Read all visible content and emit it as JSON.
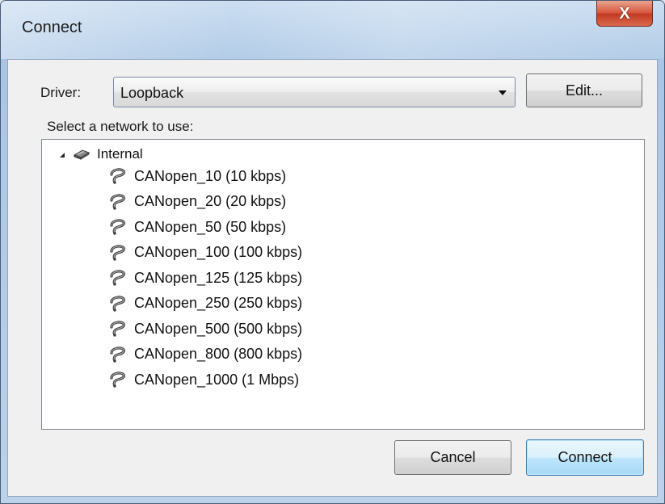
{
  "window": {
    "title": "Connect",
    "close_glyph": "X"
  },
  "driver": {
    "label": "Driver:",
    "selected": "Loopback",
    "edit_label": "Edit..."
  },
  "network": {
    "label": "Select a network to use:",
    "root": {
      "label": "Internal",
      "icon": "network-adapter-icon",
      "expanded": true
    },
    "items": [
      {
        "label": "CANopen_10 (10 kbps)",
        "icon": "connection-icon"
      },
      {
        "label": "CANopen_20 (20 kbps)",
        "icon": "connection-icon"
      },
      {
        "label": "CANopen_50 (50 kbps)",
        "icon": "connection-icon"
      },
      {
        "label": "CANopen_100 (100 kbps)",
        "icon": "connection-icon"
      },
      {
        "label": "CANopen_125 (125 kbps)",
        "icon": "connection-icon"
      },
      {
        "label": "CANopen_250 (250 kbps)",
        "icon": "connection-icon"
      },
      {
        "label": "CANopen_500 (500 kbps)",
        "icon": "connection-icon"
      },
      {
        "label": "CANopen_800 (800 kbps)",
        "icon": "connection-icon"
      },
      {
        "label": "CANopen_1000 (1 Mbps)",
        "icon": "connection-icon"
      }
    ]
  },
  "buttons": {
    "cancel_label": "Cancel",
    "connect_label": "Connect"
  },
  "colors": {
    "titlebar": "#aec9e6",
    "close_button": "#c23a22",
    "default_button_border": "#3c7fb1"
  }
}
